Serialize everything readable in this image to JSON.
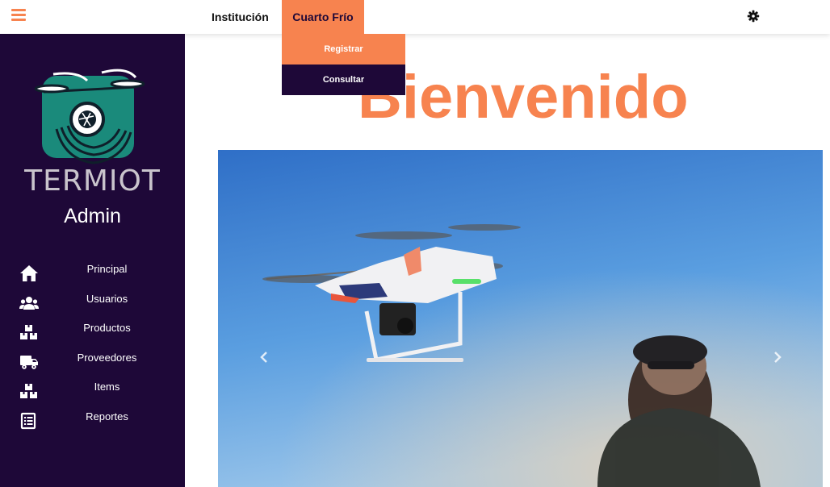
{
  "topbar": {
    "nav": [
      {
        "label": "Institución"
      },
      {
        "label": "Cuarto Frío"
      }
    ],
    "dropdown": [
      {
        "label": "Registrar"
      },
      {
        "label": "Consultar"
      }
    ]
  },
  "sidebar": {
    "brand": "TERMIOT",
    "role": "Admin",
    "items": [
      {
        "label": "Principal",
        "icon": "home-icon"
      },
      {
        "label": "Usuarios",
        "icon": "users-icon"
      },
      {
        "label": "Productos",
        "icon": "boxes-icon"
      },
      {
        "label": "Proveedores",
        "icon": "truck-icon"
      },
      {
        "label": "Items",
        "icon": "boxes-icon"
      },
      {
        "label": "Reportes",
        "icon": "report-icon"
      }
    ]
  },
  "main": {
    "title": "Bienvenido"
  },
  "colors": {
    "accent": "#f7834f",
    "sidebar": "#1e0838",
    "logo_teal": "#1a8a7b"
  }
}
